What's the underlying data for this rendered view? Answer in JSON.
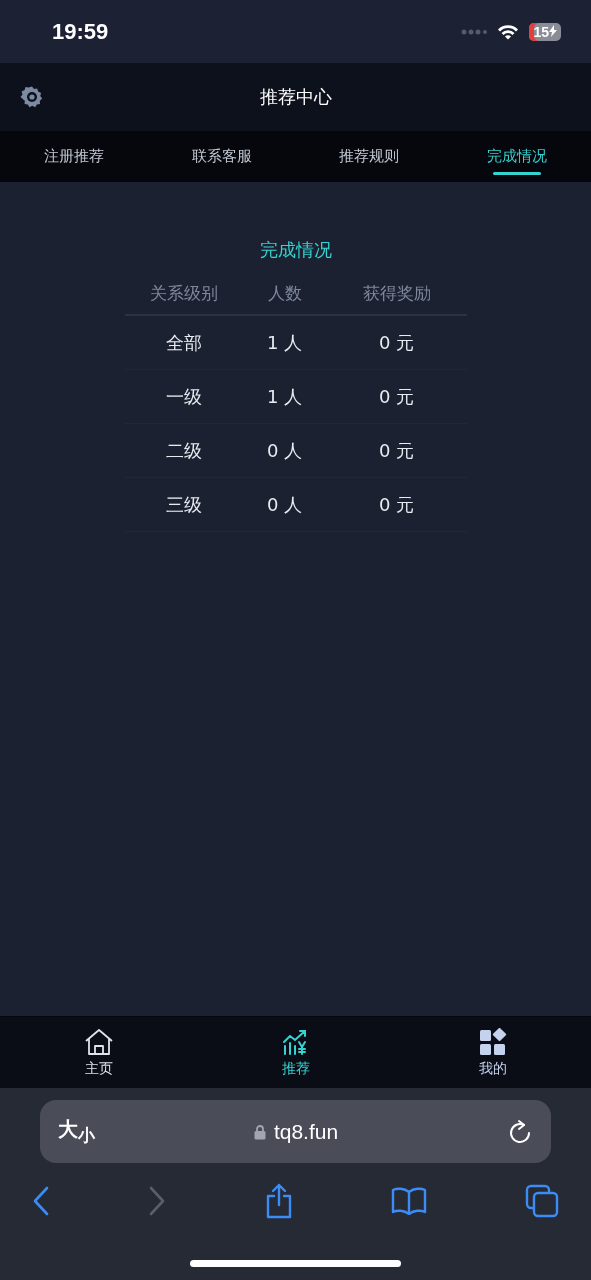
{
  "status_bar": {
    "time": "19:59",
    "battery": "15"
  },
  "header": {
    "title": "推荐中心"
  },
  "tabs": [
    {
      "label": "注册推荐",
      "selected": false
    },
    {
      "label": "联系客服",
      "selected": false
    },
    {
      "label": "推荐规则",
      "selected": false
    },
    {
      "label": "完成情况",
      "selected": true
    }
  ],
  "section_title": "完成情况",
  "table": {
    "columns": [
      "关系级别",
      "人数",
      "获得奖励"
    ],
    "rows": [
      [
        "全部",
        "1 人",
        "0 元"
      ],
      [
        "一级",
        "1 人",
        "0 元"
      ],
      [
        "二级",
        "0 人",
        "0 元"
      ],
      [
        "三级",
        "0 人",
        "0 元"
      ]
    ]
  },
  "bottom_nav": [
    {
      "label": "主页",
      "selected": false
    },
    {
      "label": "推荐",
      "selected": true
    },
    {
      "label": "我的",
      "selected": false
    }
  ],
  "browser": {
    "text_size": "大$_{小}$",
    "url": "tq8.fun",
    "forward_disabled": true
  }
}
